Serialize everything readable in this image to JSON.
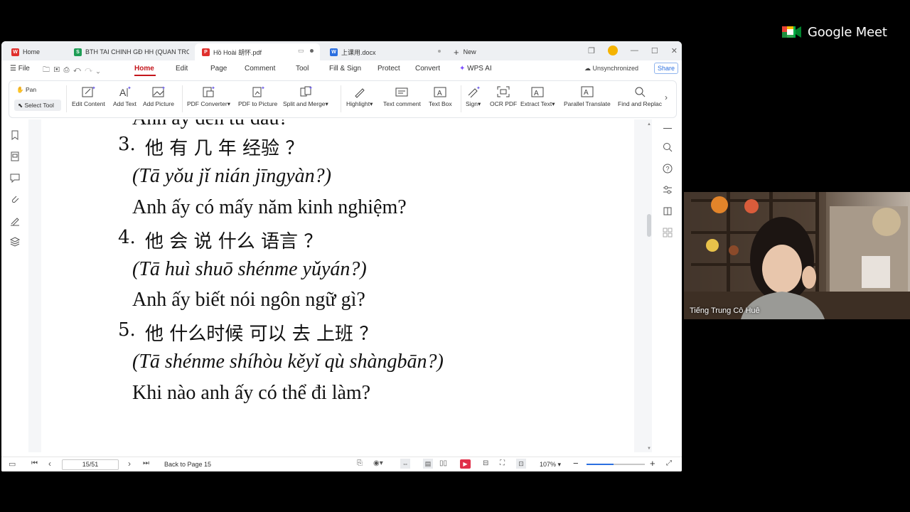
{
  "meet": {
    "brand": "Google Meet",
    "participant_name": "Tiếng Trung Cô Huê"
  },
  "tabs": [
    {
      "label": "Home",
      "icon": "wps-home-icon",
      "color": "#e0302d"
    },
    {
      "label": "BTH TAI CHINH GĐ HH (QUAN TRON",
      "icon": "spreadsheet-icon",
      "color": "#1e9d55"
    },
    {
      "label": "Hồ Hoài 胡怀.pdf",
      "icon": "pdf-icon",
      "color": "#e0302d"
    },
    {
      "label": "上课用.docx",
      "icon": "word-icon",
      "color": "#2b6fe0"
    },
    {
      "label": "New"
    }
  ],
  "menu": {
    "file": "File",
    "items": [
      "Home",
      "Edit",
      "Page",
      "Comment",
      "Tool",
      "Fill & Sign",
      "Protect",
      "Convert"
    ],
    "wps_ai": "WPS AI",
    "sync_status": "Unsynchronized",
    "share": "Share"
  },
  "ribbon": {
    "pan": "Pan",
    "select_tool": "Select Tool",
    "buttons": [
      "Edit Content",
      "Add Text",
      "Add Picture",
      "PDF Converter",
      "PDF to Picture",
      "Split and Merge",
      "Highlight",
      "Text comment",
      "Text Box",
      "Sign",
      "OCR PDF",
      "Extract Text",
      "Parallel Translate",
      "Find and Replac"
    ]
  },
  "document": {
    "partial_top": "Anh ấy đến từ đâu?",
    "items": [
      {
        "num": "3.",
        "hanzi": "他 有 几 年 经验 ？",
        "pinyin": "(Tā yǒu jǐ nián jīngyàn?)",
        "vi": "Anh ấy có mấy năm kinh nghiệm?"
      },
      {
        "num": "4.",
        "hanzi": "他 会 说 什么 语言 ？",
        "pinyin": "(Tā huì shuō shénme yǔyán?)",
        "vi": "Anh ấy biết nói ngôn ngữ gì?"
      },
      {
        "num": "5.",
        "hanzi": "他 什么时候 可以 去 上班 ？",
        "pinyin": "(Tā shénme shíhòu kěyǐ qù shàngbān?)",
        "vi": "Khi nào anh ấy có thể đi làm?"
      }
    ]
  },
  "status": {
    "page": "15/51",
    "back_to": "Back to Page 15",
    "zoom": "107%"
  }
}
